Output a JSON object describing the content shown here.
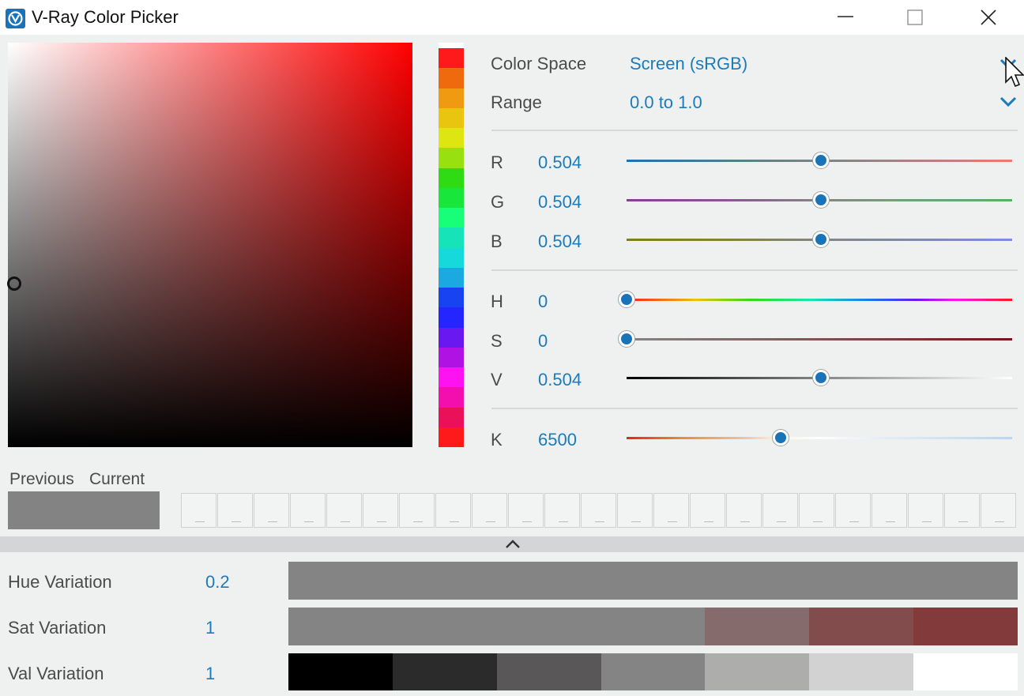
{
  "window": {
    "title": "V-Ray Color Picker",
    "icon": "vray-logo-icon",
    "controls": [
      "minimize-icon",
      "maximize-icon",
      "close-icon"
    ]
  },
  "picker": {
    "color_space_label": "Color Space",
    "color_space_value": "Screen (sRGB)",
    "range_label": "Range",
    "range_value": "0.0 to 1.0"
  },
  "channels": [
    {
      "key": "r",
      "label": "R",
      "value": "0.504",
      "fraction": 0.504
    },
    {
      "key": "g",
      "label": "G",
      "value": "0.504",
      "fraction": 0.504
    },
    {
      "key": "b",
      "label": "B",
      "value": "0.504",
      "fraction": 0.504
    },
    {
      "key": "h",
      "label": "H",
      "value": "0",
      "fraction": 0
    },
    {
      "key": "s",
      "label": "S",
      "value": "0",
      "fraction": 0
    },
    {
      "key": "v",
      "label": "V",
      "value": "0.504",
      "fraction": 0.504
    },
    {
      "key": "k",
      "label": "K",
      "value": "6500",
      "fraction": 0.4
    }
  ],
  "swatches": {
    "previous_label": "Previous",
    "current_label": "Current",
    "previous_color": "#848384",
    "history_slots": 23
  },
  "variations": [
    {
      "label": "Hue Variation",
      "value": "0.2",
      "colors": [
        "#858485",
        "#858485",
        "#858485",
        "#858485",
        "#858485",
        "#858485",
        "#858485"
      ]
    },
    {
      "label": "Sat Variation",
      "value": "1",
      "colors": [
        "#858485",
        "#858485",
        "#858485",
        "#858485",
        "#856b6b",
        "#834c4c",
        "#833a3a"
      ]
    },
    {
      "label": "Val Variation",
      "value": "1",
      "colors": [
        "#000000",
        "#2c2b2c",
        "#5a5759",
        "#858485",
        "#adadab",
        "#d2d2d2",
        "#ffffff"
      ]
    }
  ],
  "hue_strip_colors": [
    "#ff1a1a",
    "#ef6a0c",
    "#f09a12",
    "#e9c510",
    "#dde610",
    "#98e010",
    "#2fdc14",
    "#18e63a",
    "#17ff78",
    "#16e3b8",
    "#16d9dc",
    "#1aa9e0",
    "#1744f0",
    "#2525ff",
    "#6a18f0",
    "#b012e3",
    "#ff12f2",
    "#f30fad",
    "#ea1059",
    "#ff1a1a"
  ]
}
